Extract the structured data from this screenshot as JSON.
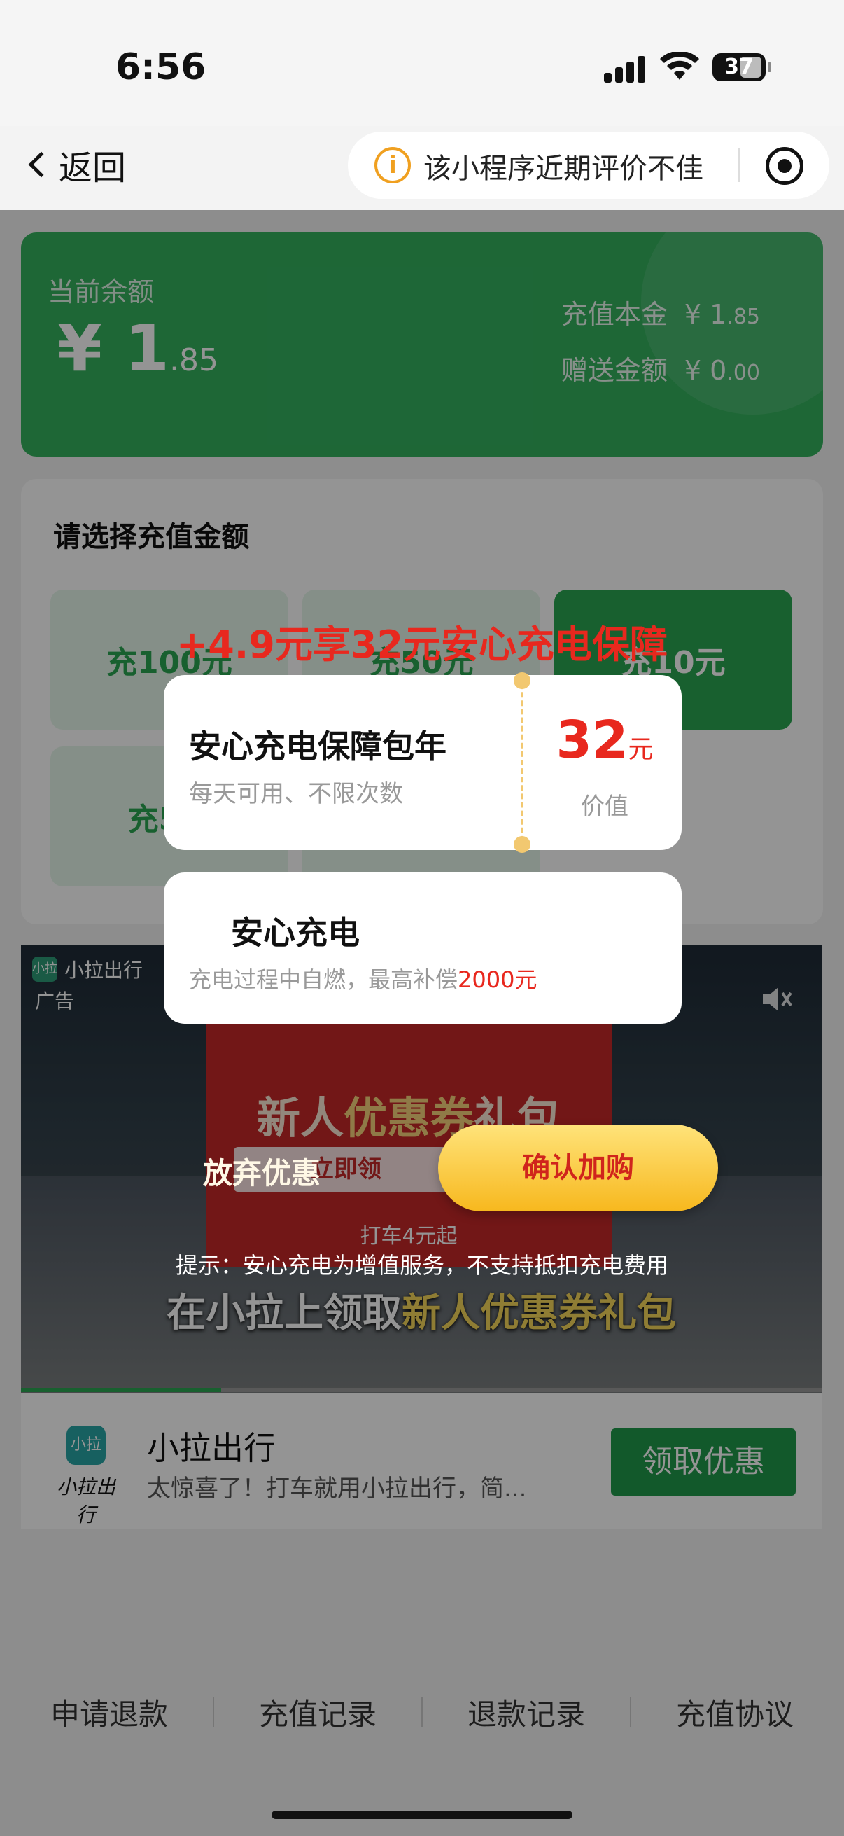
{
  "status_bar": {
    "time": "6:56",
    "battery": "37"
  },
  "nav": {
    "back_label": "返回",
    "warning_text": "该小程序近期评价不佳"
  },
  "balance": {
    "label": "当前余额",
    "amount_int": "¥ 1",
    "amount_dec": ".85",
    "principal_label": "充值本金",
    "principal_int": "¥ 1",
    "principal_dec": ".85",
    "bonus_label": "赠送金额",
    "bonus_int": "¥ 0",
    "bonus_dec": ".00"
  },
  "recharge": {
    "title": "请选择充值金额",
    "options": [
      "充100元",
      "充50元",
      "充10元",
      "充5元",
      "",
      ""
    ]
  },
  "ad": {
    "brand": "小拉出行",
    "brand_mark": "小拉",
    "tag": "广告",
    "poster_title_a": "新人",
    "poster_title_b": "优惠券",
    "poster_title_c": "礼包",
    "poster_button": "立即领",
    "poster_sub": "打车4元起",
    "caption_a": "在小拉上领取",
    "caption_b": "新人优惠券礼包",
    "progress": 0.25
  },
  "ad_footer": {
    "logo_mark": "小拉",
    "logo_word": "小拉出行",
    "name": "小拉出行",
    "desc": "太惊喜了！打车就用小拉出行，简...",
    "cta": "领取优惠"
  },
  "bottom_links": [
    "申请退款",
    "充值记录",
    "退款记录",
    "充值协议"
  ],
  "popup": {
    "promo_title": "+4.9元享32元安心充电保障",
    "ticket_title": "安心充电保障包年",
    "ticket_sub": "每天可用、不限次数",
    "ticket_value": "32",
    "ticket_unit": "元",
    "ticket_value_label": "价值",
    "info_title": "安心充电",
    "info_sub": "充电过程中自燃，最高补偿",
    "info_amount": "2000元",
    "abandon": "放弃优惠",
    "confirm": "确认加购",
    "hint": "提示：安心充电为增值服务，不支持抵扣充电费用"
  },
  "colors": {
    "green": "#34b25e",
    "red": "#e8281e",
    "gold": "#f7b81e"
  }
}
